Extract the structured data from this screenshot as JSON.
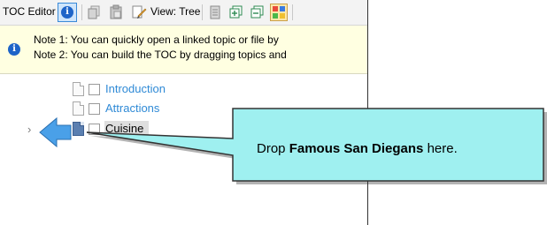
{
  "toolbar": {
    "title": "TOC Editor",
    "view_label": "View: Tree",
    "info_icon": "info-icon",
    "icons": [
      "copy-page-icon",
      "paste-page-icon",
      "view-tree-icon",
      "document-icon",
      "add-entry-icon",
      "remove-entry-icon",
      "color-grid-icon"
    ]
  },
  "notes": {
    "note1": "Note 1: You can quickly open a linked topic or file by",
    "note2": "Note 2: You can build the TOC by dragging topics and"
  },
  "tree": {
    "items": [
      {
        "label": "Introduction",
        "state": "link"
      },
      {
        "label": "Attractions",
        "state": "link"
      },
      {
        "label": "Cuisine",
        "state": "selected"
      }
    ],
    "expander": "›"
  },
  "callout": {
    "prefix": "Drop ",
    "bold": "Famous San Diegans",
    "suffix": " here."
  },
  "colors": {
    "callout_fill": "#9ff0f0",
    "callout_stroke": "#333333",
    "arrow_fill": "#4aa0e8",
    "link_text": "#2f8ad6",
    "notes_bg": "#ffffe1"
  }
}
